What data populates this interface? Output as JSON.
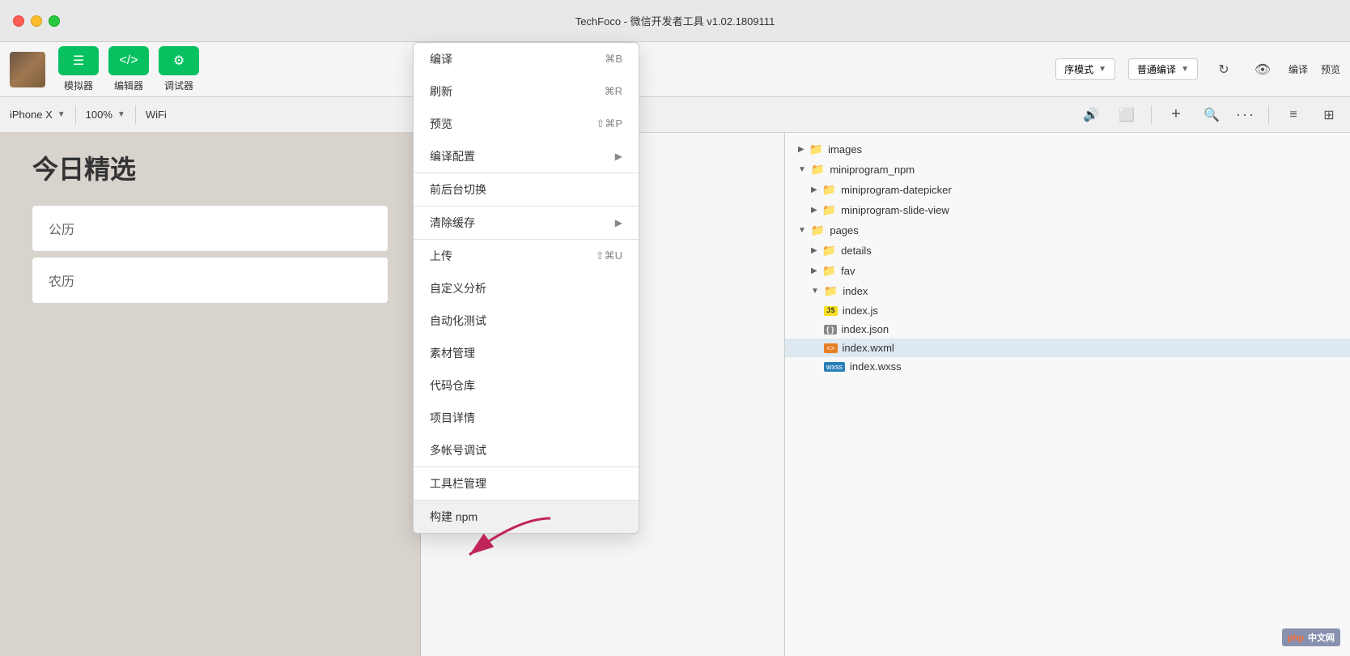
{
  "titlebar": {
    "title": "TechFoco - 微信开发者工具 v1.02.1809111",
    "traffic_lights": [
      "red",
      "yellow",
      "green"
    ]
  },
  "toolbar": {
    "avatar_alt": "user avatar",
    "buttons": [
      {
        "id": "simulator",
        "icon": "☰",
        "label": "模拟器"
      },
      {
        "id": "editor",
        "icon": "</>",
        "label": "编辑器"
      },
      {
        "id": "debugger",
        "icon": "⚙",
        "label": "调试器"
      }
    ],
    "mode_select": {
      "label": "序模式",
      "options": [
        "序模式"
      ]
    },
    "compile_select": {
      "label": "普通编译",
      "options": [
        "普通编译"
      ]
    },
    "compile_btn": "编译",
    "preview_btn": "预览"
  },
  "toolbar2": {
    "device": "iPhone X",
    "zoom": "100%",
    "network": "WiFi",
    "icons": [
      "sound",
      "screen"
    ]
  },
  "dropdown_menu": {
    "sections": [
      {
        "items": [
          {
            "label": "编译",
            "shortcut": "⌘B",
            "has_arrow": false
          },
          {
            "label": "刷新",
            "shortcut": "⌘R",
            "has_arrow": false
          },
          {
            "label": "预览",
            "shortcut": "⇧⌘P",
            "has_arrow": false
          },
          {
            "label": "编译配置",
            "shortcut": "",
            "has_arrow": true
          }
        ]
      },
      {
        "items": [
          {
            "label": "前后台切换",
            "shortcut": "",
            "has_arrow": false
          }
        ]
      },
      {
        "items": [
          {
            "label": "清除缓存",
            "shortcut": "",
            "has_arrow": true
          }
        ]
      },
      {
        "items": [
          {
            "label": "上传",
            "shortcut": "⇧⌘U",
            "has_arrow": false
          },
          {
            "label": "自定义分析",
            "shortcut": "",
            "has_arrow": false
          },
          {
            "label": "自动化测试",
            "shortcut": "",
            "has_arrow": false
          },
          {
            "label": "素材管理",
            "shortcut": "",
            "has_arrow": false
          },
          {
            "label": "代码仓库",
            "shortcut": "",
            "has_arrow": false
          },
          {
            "label": "项目详情",
            "shortcut": "",
            "has_arrow": false
          },
          {
            "label": "多帐号调试",
            "shortcut": "",
            "has_arrow": false
          }
        ]
      },
      {
        "items": [
          {
            "label": "工具栏管理",
            "shortcut": "",
            "has_arrow": false
          }
        ]
      },
      {
        "items": [
          {
            "label": "构建 npm",
            "shortcut": "",
            "has_arrow": false,
            "highlighted": true
          }
        ]
      }
    ]
  },
  "simulator": {
    "title": "今日精选",
    "rows": [
      "公历",
      "农历"
    ]
  },
  "filetree": {
    "items": [
      {
        "level": 0,
        "type": "folder",
        "name": "images",
        "expanded": false
      },
      {
        "level": 0,
        "type": "folder",
        "name": "miniprogram_npm",
        "expanded": true
      },
      {
        "level": 1,
        "type": "folder",
        "name": "miniprogram-datepicker",
        "expanded": false
      },
      {
        "level": 1,
        "type": "folder",
        "name": "miniprogram-slide-view",
        "expanded": false
      },
      {
        "level": 0,
        "type": "folder",
        "name": "pages",
        "expanded": true
      },
      {
        "level": 1,
        "type": "folder",
        "name": "details",
        "expanded": false
      },
      {
        "level": 1,
        "type": "folder",
        "name": "fav",
        "expanded": false
      },
      {
        "level": 1,
        "type": "folder",
        "name": "index",
        "expanded": true
      },
      {
        "level": 2,
        "type": "js",
        "name": "index.js"
      },
      {
        "level": 2,
        "type": "json",
        "name": "index.json"
      },
      {
        "level": 2,
        "type": "wxml",
        "name": "index.wxml",
        "selected": true
      },
      {
        "level": 2,
        "type": "wxss",
        "name": "index.wxss"
      }
    ]
  },
  "watermark": {
    "text": "php",
    "suffix": "中文网"
  }
}
